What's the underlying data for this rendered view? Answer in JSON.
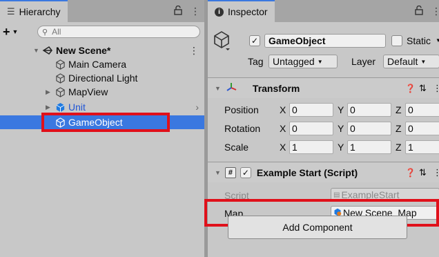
{
  "hierarchy": {
    "tab_label": "Hierarchy",
    "search_placeholder": "All",
    "items": [
      {
        "label": "New Scene*"
      },
      {
        "label": "Main Camera"
      },
      {
        "label": "Directional Light"
      },
      {
        "label": "MapView"
      },
      {
        "label": "Unit"
      },
      {
        "label": "GameObject"
      }
    ]
  },
  "inspector": {
    "tab_label": "Inspector",
    "object_name": "GameObject",
    "static_label": "Static",
    "tag_label": "Tag",
    "tag_value": "Untagged",
    "layer_label": "Layer",
    "layer_value": "Default",
    "transform": {
      "title": "Transform",
      "rows": [
        {
          "label": "Position",
          "x": "0",
          "y": "0",
          "z": "0"
        },
        {
          "label": "Rotation",
          "x": "0",
          "y": "0",
          "z": "0"
        },
        {
          "label": "Scale",
          "x": "1",
          "y": "1",
          "z": "1"
        }
      ]
    },
    "script_component": {
      "title": "Example Start (Script)",
      "script_label": "Script",
      "script_value": "ExampleStart",
      "map_label": "Map",
      "map_value": "New Scene_Map"
    },
    "add_component_label": "Add Component"
  },
  "colors": {
    "selection": "#3a78e0",
    "highlight_box": "#e0101a",
    "unit_prefab": "#1f55d6"
  }
}
